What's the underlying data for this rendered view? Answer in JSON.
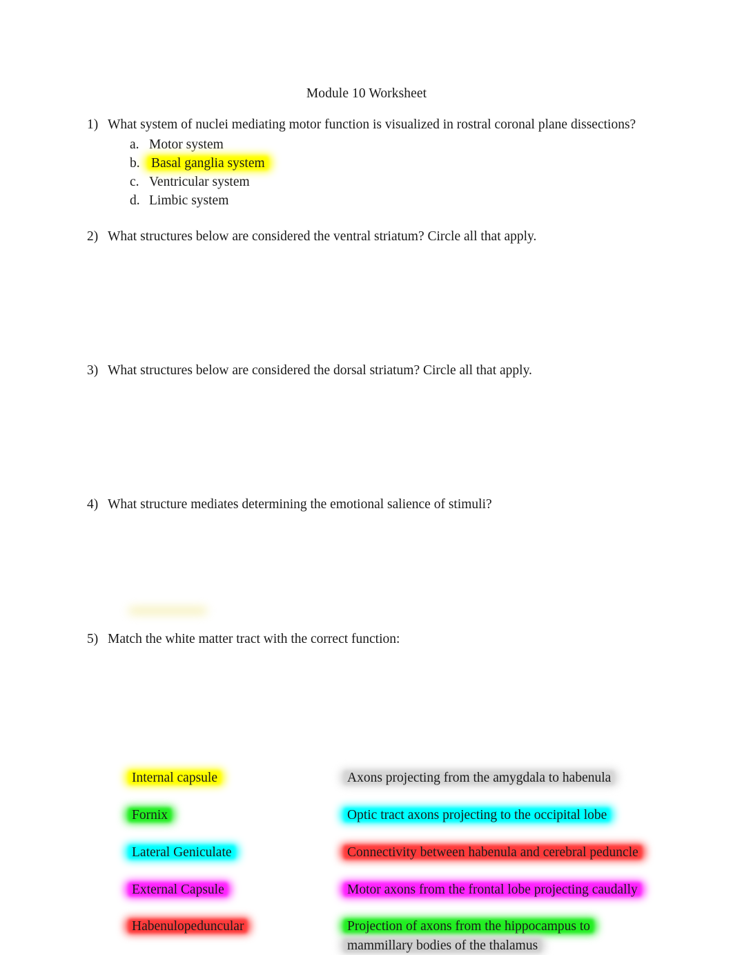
{
  "document": {
    "title": "Module 10 Worksheet",
    "page_background": "#ffffff",
    "text_color": "#1a1a1a"
  },
  "questions": [
    {
      "number": "1)",
      "text": "What system of nuclei mediating motor function is visualized in rostral coronal plane dissections?",
      "options": [
        {
          "letter": "a.",
          "text": "Motor system",
          "highlight": "none"
        },
        {
          "letter": "b.",
          "text": "Basal ganglia system",
          "highlight": "yellow"
        },
        {
          "letter": "c.",
          "text": "Ventricular system",
          "highlight": "none"
        },
        {
          "letter": "d.",
          "text": "Limbic system",
          "highlight": "none"
        }
      ]
    },
    {
      "number": "2)",
      "text": "What structures below are considered the ventral striatum? Circle all that apply.",
      "options": []
    },
    {
      "number": "3)",
      "text": "What structures below are considered the dorsal striatum? Circle all that apply.",
      "options": []
    },
    {
      "number": "4)",
      "text": "What structure mediates determining the emotional salience of stimuli?",
      "options": []
    },
    {
      "number": "5)",
      "text": "Match the white matter tract with the correct function:",
      "options": []
    }
  ],
  "matching": {
    "tracts": [
      {
        "label": "Internal capsule",
        "highlight": "yellow"
      },
      {
        "label": "Fornix",
        "highlight": "green"
      },
      {
        "label": "Lateral Geniculate",
        "highlight": "cyan"
      },
      {
        "label": "External Capsule",
        "highlight": "magenta"
      },
      {
        "label": "Habenulopeduncular",
        "highlight": "red"
      }
    ],
    "functions": [
      {
        "label": "Axons projecting from the amygdala to habenula",
        "highlight": "gray"
      },
      {
        "label": "Optic tract axons projecting to the occipital lobe",
        "highlight": "cyan"
      },
      {
        "label": "Connectivity between habenula and cerebral peduncle",
        "highlight": "red"
      },
      {
        "label": "Motor axons from the frontal lobe projecting caudally",
        "highlight": "magenta"
      },
      {
        "label": "Projection of axons from the hippocampus to",
        "line2": "mammillary bodies of the thalamus",
        "highlight": "green",
        "highlight_line2": "gray"
      }
    ]
  },
  "highlight_colors": {
    "yellow": "#ffff00",
    "green": "#22ee22",
    "cyan": "#00ffff",
    "magenta": "#ff22ff",
    "red": "#ff3b3b",
    "gray": "#d5d5d5",
    "faded_yellow": "#f7f0a8"
  }
}
